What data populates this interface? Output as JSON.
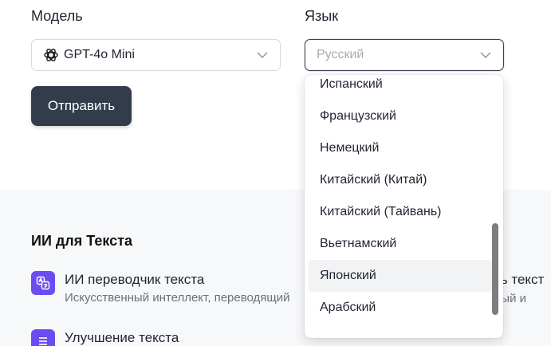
{
  "form": {
    "model_label": "Модель",
    "model_value": "GPT-4o Mini",
    "language_label": "Язык",
    "language_placeholder": "Русский",
    "submit_label": "Отправить"
  },
  "language_dropdown": {
    "options": [
      "Испанский",
      "Французский",
      "Немецкий",
      "Китайский (Китай)",
      "Китайский (Тайвань)",
      "Вьетнамский",
      "Японский",
      "Арабский"
    ],
    "highlighted": "Японский"
  },
  "text_ai": {
    "heading": "ИИ для Текста",
    "tools": [
      {
        "title": "ИИ переводчик текста",
        "description": "Искусственный интеллект, переводящий"
      },
      {
        "title": "Улучшение текста",
        "description": ""
      }
    ],
    "partial_right_title": "ть текст",
    "partial_right_desc": "ный и"
  },
  "icons": {
    "model": "openai-icon",
    "dropdown": "chevron-down-icon",
    "translator": "translate-icon",
    "improve": "list-icon"
  },
  "colors": {
    "primary_button": "#323c4b",
    "tool_icon": "#6a4cf0",
    "lower_background": "#f7f8fa"
  }
}
